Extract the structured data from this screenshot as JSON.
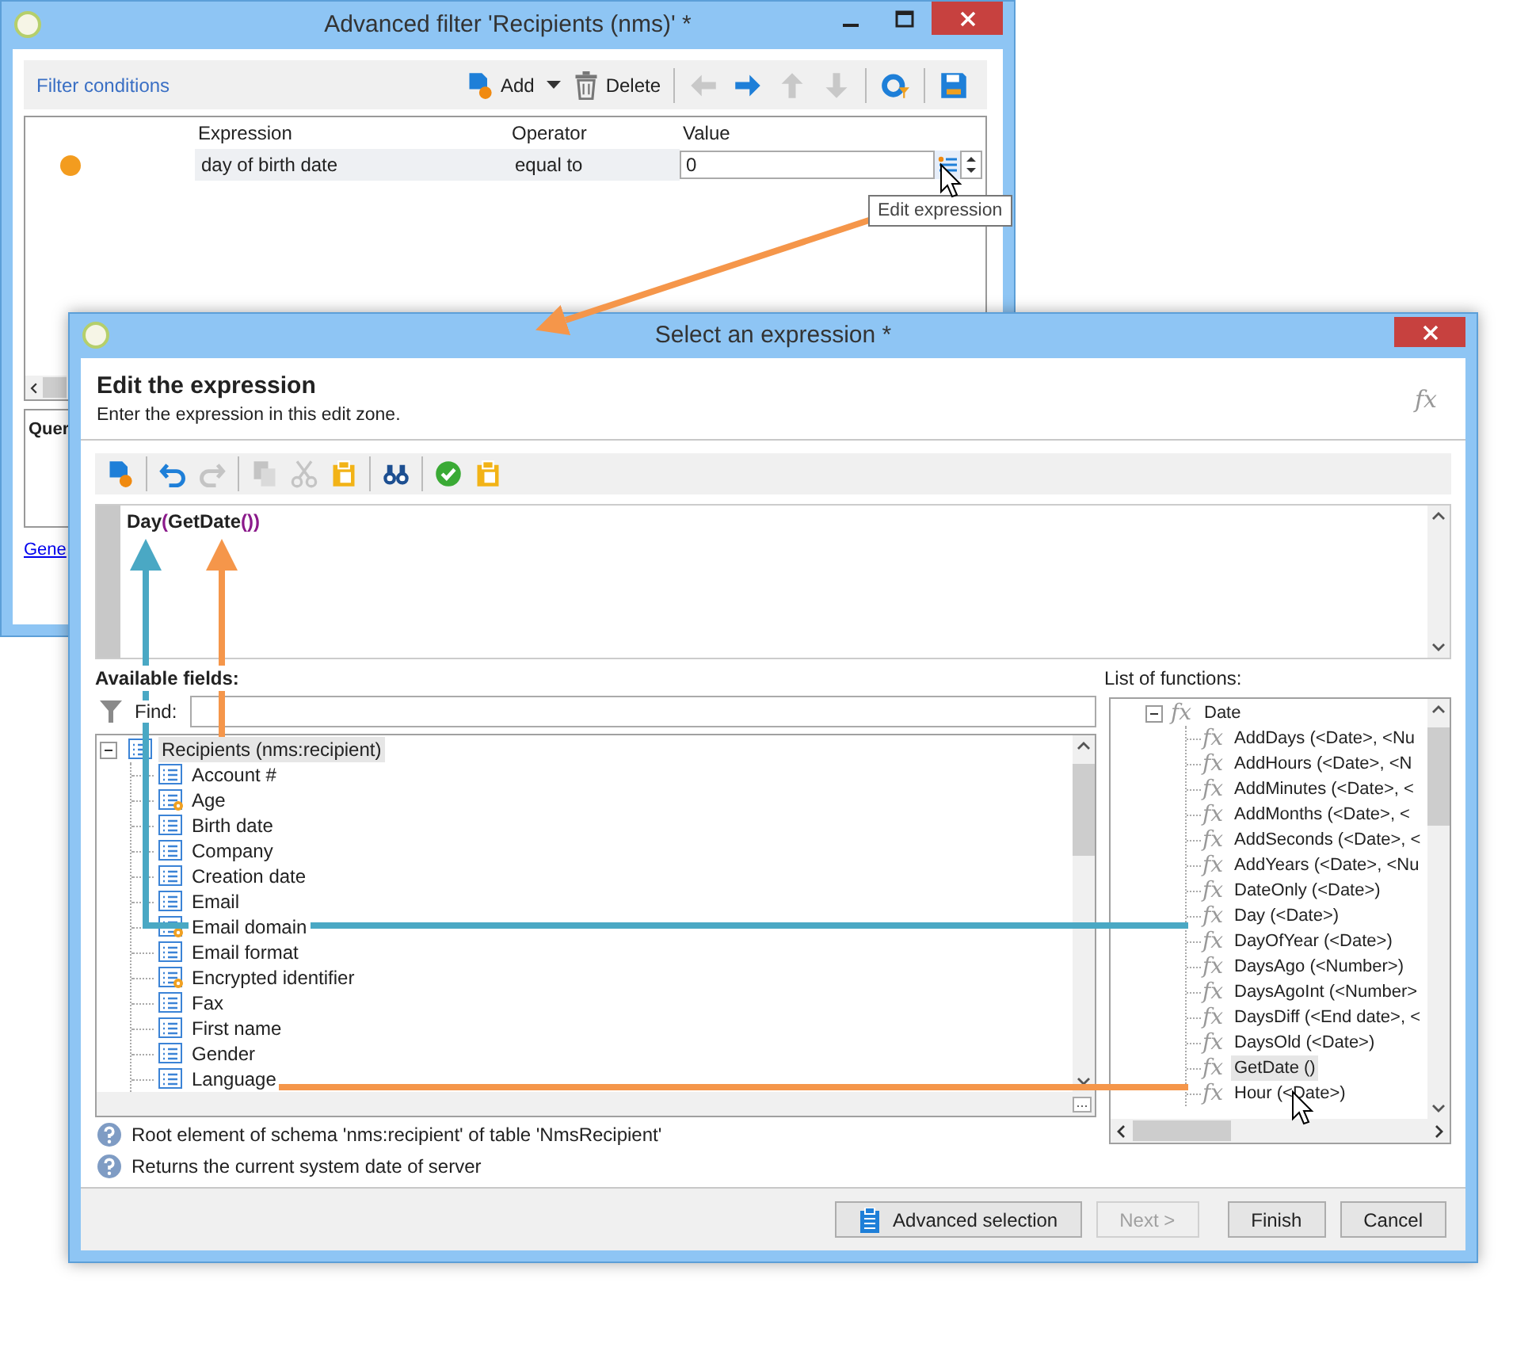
{
  "filter_window": {
    "title": "Advanced filter 'Recipients (nms)' *",
    "section_title": "Filter conditions",
    "actions": [
      {
        "label": "Add",
        "has_menu": true
      },
      {
        "label": "Delete",
        "has_menu": false
      }
    ],
    "icon_buttons": [
      {
        "disabled": true
      },
      {
        "disabled": false
      },
      {
        "disabled": true
      },
      {
        "disabled": true
      },
      {
        "disabled": false
      },
      {
        "disabled": false
      }
    ],
    "columns": [
      "Expression",
      "Operator",
      "Value"
    ],
    "rows": [
      {
        "color": "#f39c1f",
        "expression": "day of birth date",
        "operator": "equal to",
        "value": "0"
      }
    ],
    "tooltip": "Edit expression",
    "query_label": "Quer",
    "link": "Gene"
  },
  "expression_window": {
    "title": "Select an expression *",
    "heading": "Edit the expression",
    "subtitle": "Enter the expression in this edit zone.",
    "fx_glyph": "fx",
    "toolbar": [
      {
        "disabled": false
      },
      {
        "disabled": false
      },
      {
        "disabled": true
      },
      {
        "disabled": true
      },
      {
        "disabled": true
      },
      {
        "disabled": false
      },
      {
        "disabled": false
      },
      {
        "disabled": false
      },
      {
        "disabled": false
      }
    ],
    "expression": "Day(GetDate())",
    "fields_label": "Available fields:",
    "find_label": "Find:",
    "fields_tree": {
      "label": "Recipients (nms:recipient)",
      "expanded": true,
      "selected": true,
      "children": [
        {
          "label": "Account #",
          "kind": "field",
          "selected": false
        },
        {
          "label": "Age",
          "kind": "computed",
          "selected": false
        },
        {
          "label": "Birth date",
          "kind": "field",
          "selected": false
        },
        {
          "label": "Company",
          "kind": "field",
          "selected": false
        },
        {
          "label": "Creation date",
          "kind": "field",
          "selected": false
        },
        {
          "label": "Email",
          "kind": "field",
          "selected": false
        },
        {
          "label": "Email domain",
          "kind": "computed",
          "selected": false
        },
        {
          "label": "Email format",
          "kind": "field",
          "selected": false
        },
        {
          "label": "Encrypted identifier",
          "kind": "computed",
          "selected": false
        },
        {
          "label": "Fax",
          "kind": "field",
          "selected": false
        },
        {
          "label": "First name",
          "kind": "field",
          "selected": false
        },
        {
          "label": "Gender",
          "kind": "field",
          "selected": false
        },
        {
          "label": "Language",
          "kind": "field",
          "selected": false
        }
      ]
    },
    "functions_label": "List of functions:",
    "functions_tree": {
      "glyph": "fx",
      "label": "Date",
      "expanded": true,
      "children": [
        {
          "glyph": "fx",
          "label": "AddDays (<Date>, <Nu",
          "selected": false
        },
        {
          "glyph": "fx",
          "label": "AddHours (<Date>, <N",
          "selected": false
        },
        {
          "glyph": "fx",
          "label": "AddMinutes (<Date>, <",
          "selected": false
        },
        {
          "glyph": "fx",
          "label": "AddMonths (<Date>, <",
          "selected": false
        },
        {
          "glyph": "fx",
          "label": "AddSeconds (<Date>, <",
          "selected": false
        },
        {
          "glyph": "fx",
          "label": "AddYears (<Date>, <Nu",
          "selected": false
        },
        {
          "glyph": "fx",
          "label": "DateOnly (<Date>)",
          "selected": false
        },
        {
          "glyph": "fx",
          "label": "Day (<Date>)",
          "selected": false
        },
        {
          "glyph": "fx",
          "label": "DayOfYear (<Date>)",
          "selected": false
        },
        {
          "glyph": "fx",
          "label": "DaysAgo (<Number>)",
          "selected": false
        },
        {
          "glyph": "fx",
          "label": "DaysAgoInt (<Number>",
          "selected": false
        },
        {
          "glyph": "fx",
          "label": "DaysDiff (<End date>, <",
          "selected": false
        },
        {
          "glyph": "fx",
          "label": "DaysOld (<Date>)",
          "selected": false
        },
        {
          "glyph": "fx",
          "label": "GetDate ()",
          "selected": true
        },
        {
          "glyph": "fx",
          "label": "Hour (<Date>)",
          "selected": false
        }
      ]
    },
    "info": [
      "Root element of schema 'nms:recipient' of table 'NmsRecipient'",
      "Returns the current system date of server"
    ],
    "buttons": [
      {
        "label": "Advanced selection",
        "disabled": false
      },
      {
        "label": "Next >",
        "disabled": true
      },
      {
        "label": "Finish",
        "disabled": false
      },
      {
        "label": "Cancel",
        "disabled": false
      }
    ]
  }
}
